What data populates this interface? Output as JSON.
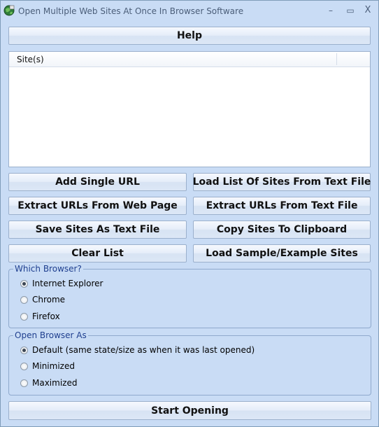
{
  "window": {
    "title": "Open Multiple Web Sites At Once In Browser Software",
    "controls": {
      "minimize": "–",
      "maximize": "▭",
      "close": "X"
    }
  },
  "help_button": "Help",
  "site_list": {
    "column_header": "Site(s)",
    "rows": []
  },
  "buttons": {
    "add_single_url": "Add Single URL",
    "load_list_from_text_file": "Load List Of Sites From Text File",
    "extract_from_web_page": "Extract URLs From Web Page",
    "extract_from_text_file": "Extract URLs From Text File",
    "save_as_text_file": "Save Sites As Text File",
    "copy_to_clipboard": "Copy Sites To Clipboard",
    "clear_list": "Clear List",
    "load_sample_sites": "Load Sample/Example Sites"
  },
  "which_browser": {
    "label": "Which Browser?",
    "options": [
      "Internet Explorer",
      "Chrome",
      "Firefox"
    ],
    "selected": "Internet Explorer"
  },
  "open_browser_as": {
    "label": "Open Browser As",
    "options": [
      "Default (same state/size as when it was last opened)",
      "Minimized",
      "Maximized"
    ],
    "selected": "Default (same state/size as when it was last opened)"
  },
  "start_button": "Start Opening"
}
